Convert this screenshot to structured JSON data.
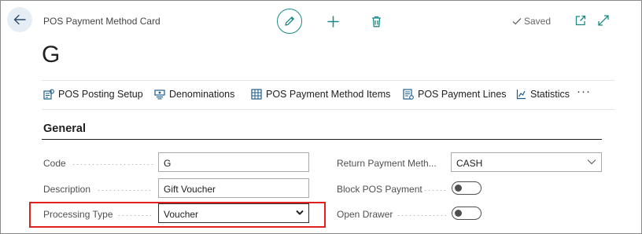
{
  "header": {
    "caption": "POS Payment Method Card",
    "title": "G",
    "saved_label": "Saved"
  },
  "actions": [
    {
      "label": "POS Posting Setup",
      "icon": "posting-setup-icon"
    },
    {
      "label": "Denominations",
      "icon": "denominations-icon"
    },
    {
      "label": "POS Payment Method Items",
      "icon": "payment-method-items-icon"
    },
    {
      "label": "POS Payment Lines",
      "icon": "payment-lines-icon"
    },
    {
      "label": "Statistics",
      "icon": "statistics-icon"
    }
  ],
  "more_label": "···",
  "section": {
    "title": "General"
  },
  "fields": {
    "code": {
      "label": "Code",
      "value": "G"
    },
    "description": {
      "label": "Description",
      "value": "Gift Voucher"
    },
    "processing_type": {
      "label": "Processing Type",
      "value": "Voucher"
    },
    "return_payment_method": {
      "label": "Return Payment Meth...",
      "value": "CASH"
    },
    "block_pos_payment": {
      "label": "Block POS Payment",
      "value": "off"
    },
    "open_drawer": {
      "label": "Open Drawer",
      "value": "off"
    }
  },
  "colors": {
    "accent": "#1a8a84",
    "highlight": "#e0201c"
  }
}
